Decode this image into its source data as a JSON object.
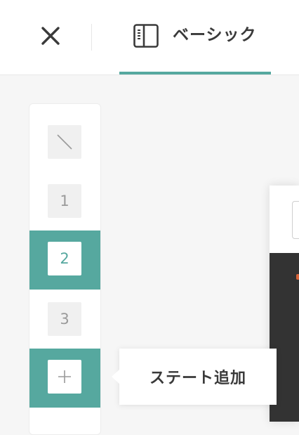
{
  "header": {
    "close_icon": "close-icon",
    "tab": {
      "icon": "sidebar-panel-icon",
      "label": "ベーシック",
      "accent_color": "#56a89f"
    }
  },
  "states": {
    "items": [
      {
        "label": "",
        "icon": "none-slash-icon",
        "active": false
      },
      {
        "label": "1",
        "active": false
      },
      {
        "label": "2",
        "active": true
      },
      {
        "label": "3",
        "active": false
      },
      {
        "label": "",
        "icon": "plus-icon",
        "active": true
      }
    ],
    "add_tooltip": "ステート追加"
  },
  "colors": {
    "accent": "#56a89f",
    "text": "#3a3a3a",
    "muted": "#9a9a9a",
    "canvas_dark": "#333333",
    "canvas_mark": "#d8643a"
  }
}
